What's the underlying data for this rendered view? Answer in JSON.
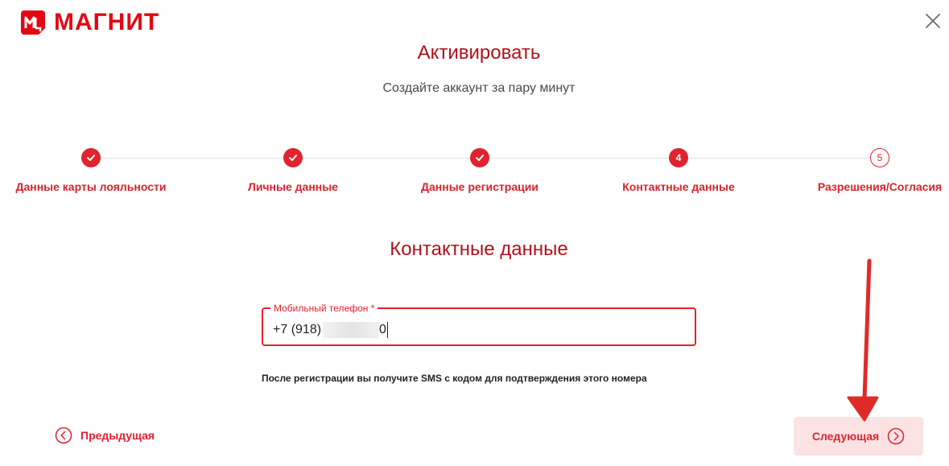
{
  "brand": {
    "name": "МАГНИТ",
    "color": "#e30613"
  },
  "title": "Активировать",
  "subtitle": "Создайте аккаунт за пару минут",
  "steps": [
    {
      "label": "Данные карты лояльности",
      "status": "done",
      "number": "1"
    },
    {
      "label": "Личные данные",
      "status": "done",
      "number": "2"
    },
    {
      "label": "Данные регистрации",
      "status": "done",
      "number": "3"
    },
    {
      "label": "Контактные данные",
      "status": "active",
      "number": "4"
    },
    {
      "label": "Разрешения/Согласия",
      "status": "pending",
      "number": "5"
    }
  ],
  "section_title": "Контактные данные",
  "phone_field": {
    "label": "Мобильный телефон *",
    "value_prefix": "+7 (918)",
    "value_suffix": "0"
  },
  "hint": "После регистрации вы получите SMS с кодом для подтверждения этого номера",
  "buttons": {
    "prev_label": "Предыдущая",
    "next_label": "Следующая"
  },
  "icons": {
    "close": "close-icon",
    "check": "check-icon",
    "prev": "chevron-left-circle-icon",
    "next": "chevron-right-circle-icon"
  },
  "colors": {
    "accent": "#e1232f",
    "title": "#b3111c",
    "next_bg": "#fbe3e4",
    "annotation": "#e02a2a"
  }
}
